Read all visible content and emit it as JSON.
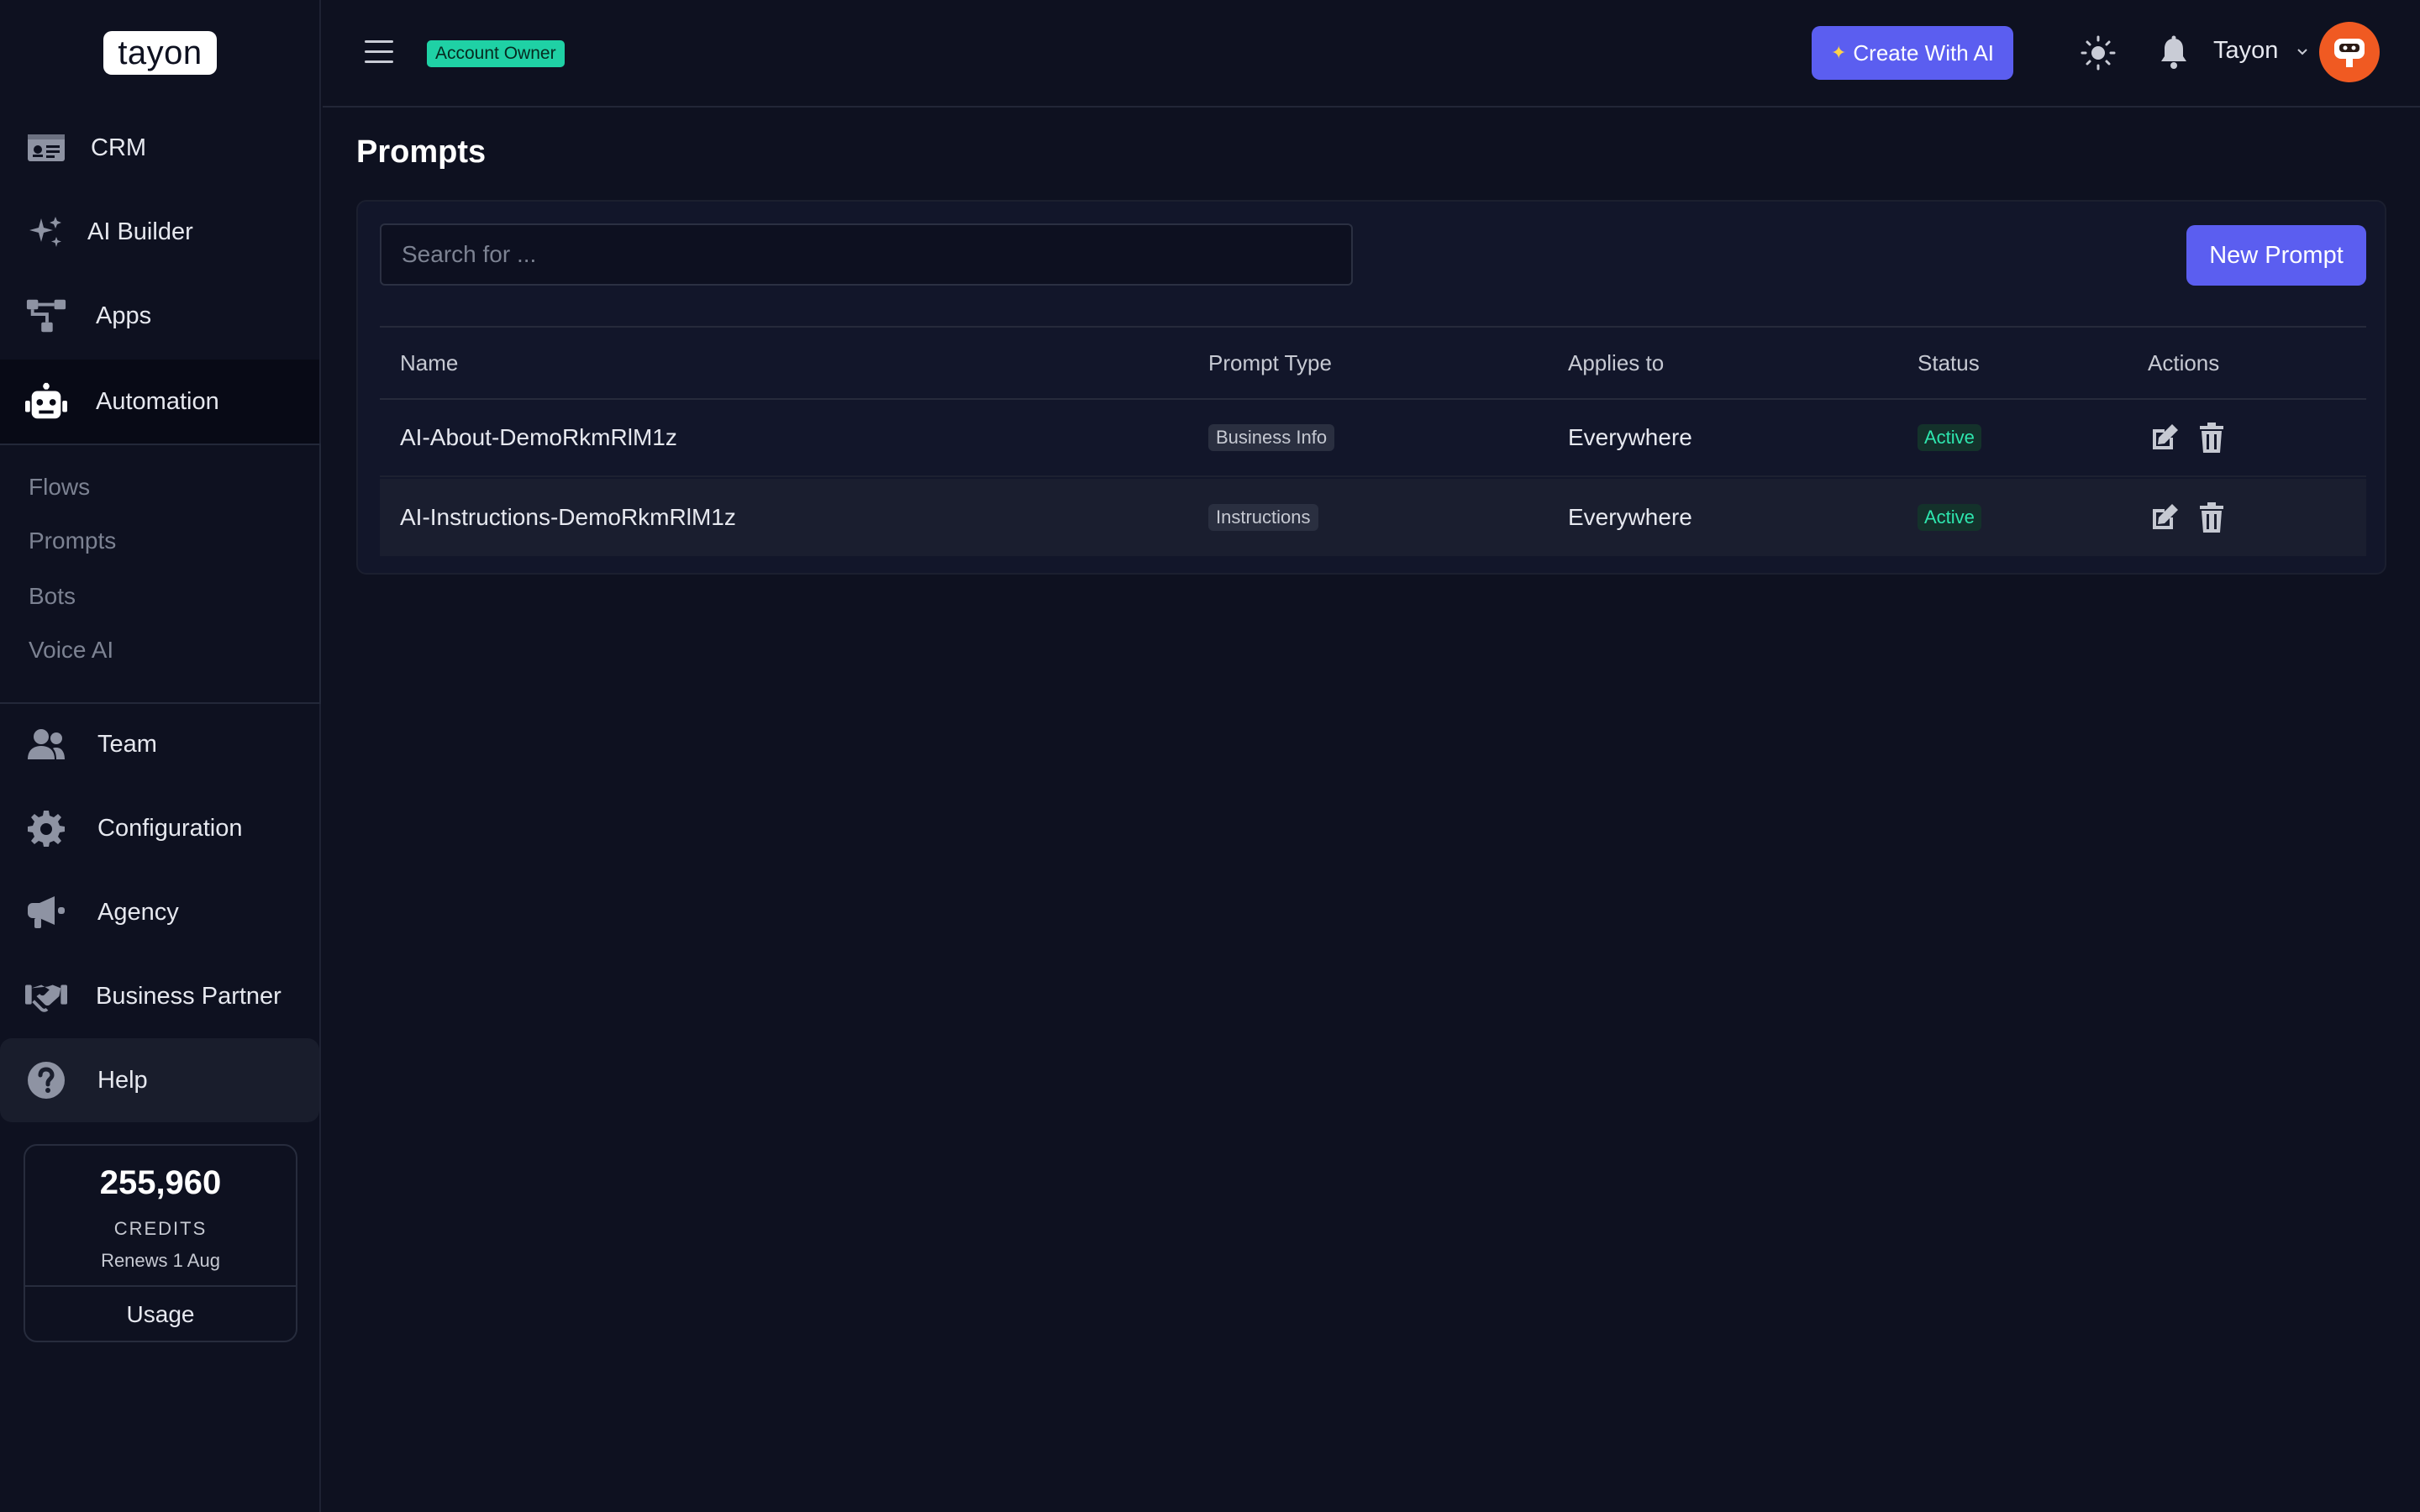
{
  "app": {
    "logo_text": "tayon"
  },
  "sidebar": {
    "items": [
      {
        "label": "CRM",
        "icon": "id-card-icon"
      },
      {
        "label": "AI Builder",
        "icon": "sparkles-icon"
      },
      {
        "label": "Apps",
        "icon": "sitemap-icon"
      },
      {
        "label": "Automation",
        "icon": "robot-icon"
      },
      {
        "label": "Team",
        "icon": "users-icon"
      },
      {
        "label": "Configuration",
        "icon": "gear-icon"
      },
      {
        "label": "Agency",
        "icon": "megaphone-icon"
      },
      {
        "label": "Business Partner",
        "icon": "handshake-icon"
      },
      {
        "label": "Help",
        "icon": "question-circle-icon"
      }
    ],
    "submenu": [
      "Flows",
      "Prompts",
      "Bots",
      "Voice AI"
    ],
    "credits": {
      "amount": "255,960",
      "label": "CREDITS",
      "renews": "Renews 1 Aug",
      "usage_label": "Usage"
    }
  },
  "header": {
    "role_badge": "Account Owner",
    "create_ai_label": "Create With AI",
    "user_name": "Tayon"
  },
  "main": {
    "title": "Prompts",
    "search_placeholder": "Search for ...",
    "new_button": "New Prompt",
    "columns": [
      "Name",
      "Prompt Type",
      "Applies to",
      "Status",
      "Actions"
    ],
    "rows": [
      {
        "name": "AI-About-DemoRkmRlM1z",
        "type": "Business Info",
        "applies": "Everywhere",
        "status": "Active"
      },
      {
        "name": "AI-Instructions-DemoRkmRlM1z",
        "type": "Instructions",
        "applies": "Everywhere",
        "status": "Active"
      }
    ]
  },
  "colors": {
    "accent": "#5b5ef0",
    "success": "#2ee6ae",
    "badge_green": "#1fd1a5",
    "avatar": "#f05a22"
  }
}
